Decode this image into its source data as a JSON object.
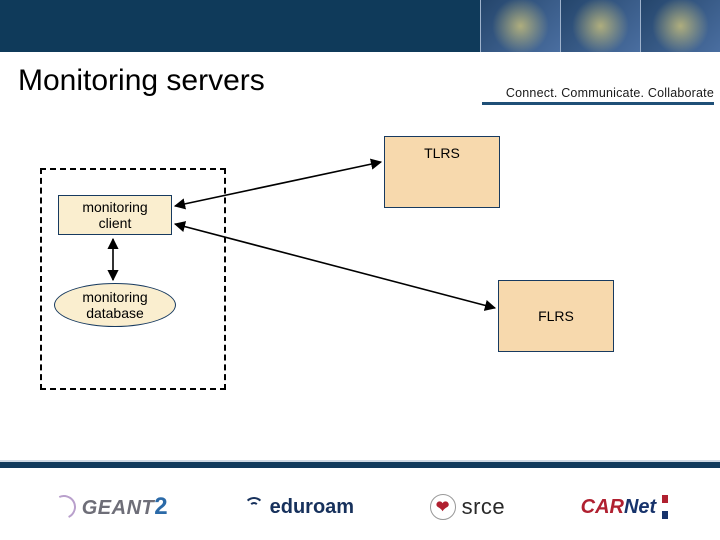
{
  "title": "Monitoring servers",
  "tagline": "Connect. Communicate. Collaborate",
  "boxes": {
    "client": "monitoring\nclient",
    "database": "monitoring\ndatabase",
    "tlrs": "TLRS",
    "flrs": "FLRS"
  },
  "logos": {
    "geant": "GEANT",
    "geant_suffix": "2",
    "eduroam": "eduroam",
    "srce": "srce",
    "carnet_car": "CAR",
    "carnet_net": "Net"
  }
}
